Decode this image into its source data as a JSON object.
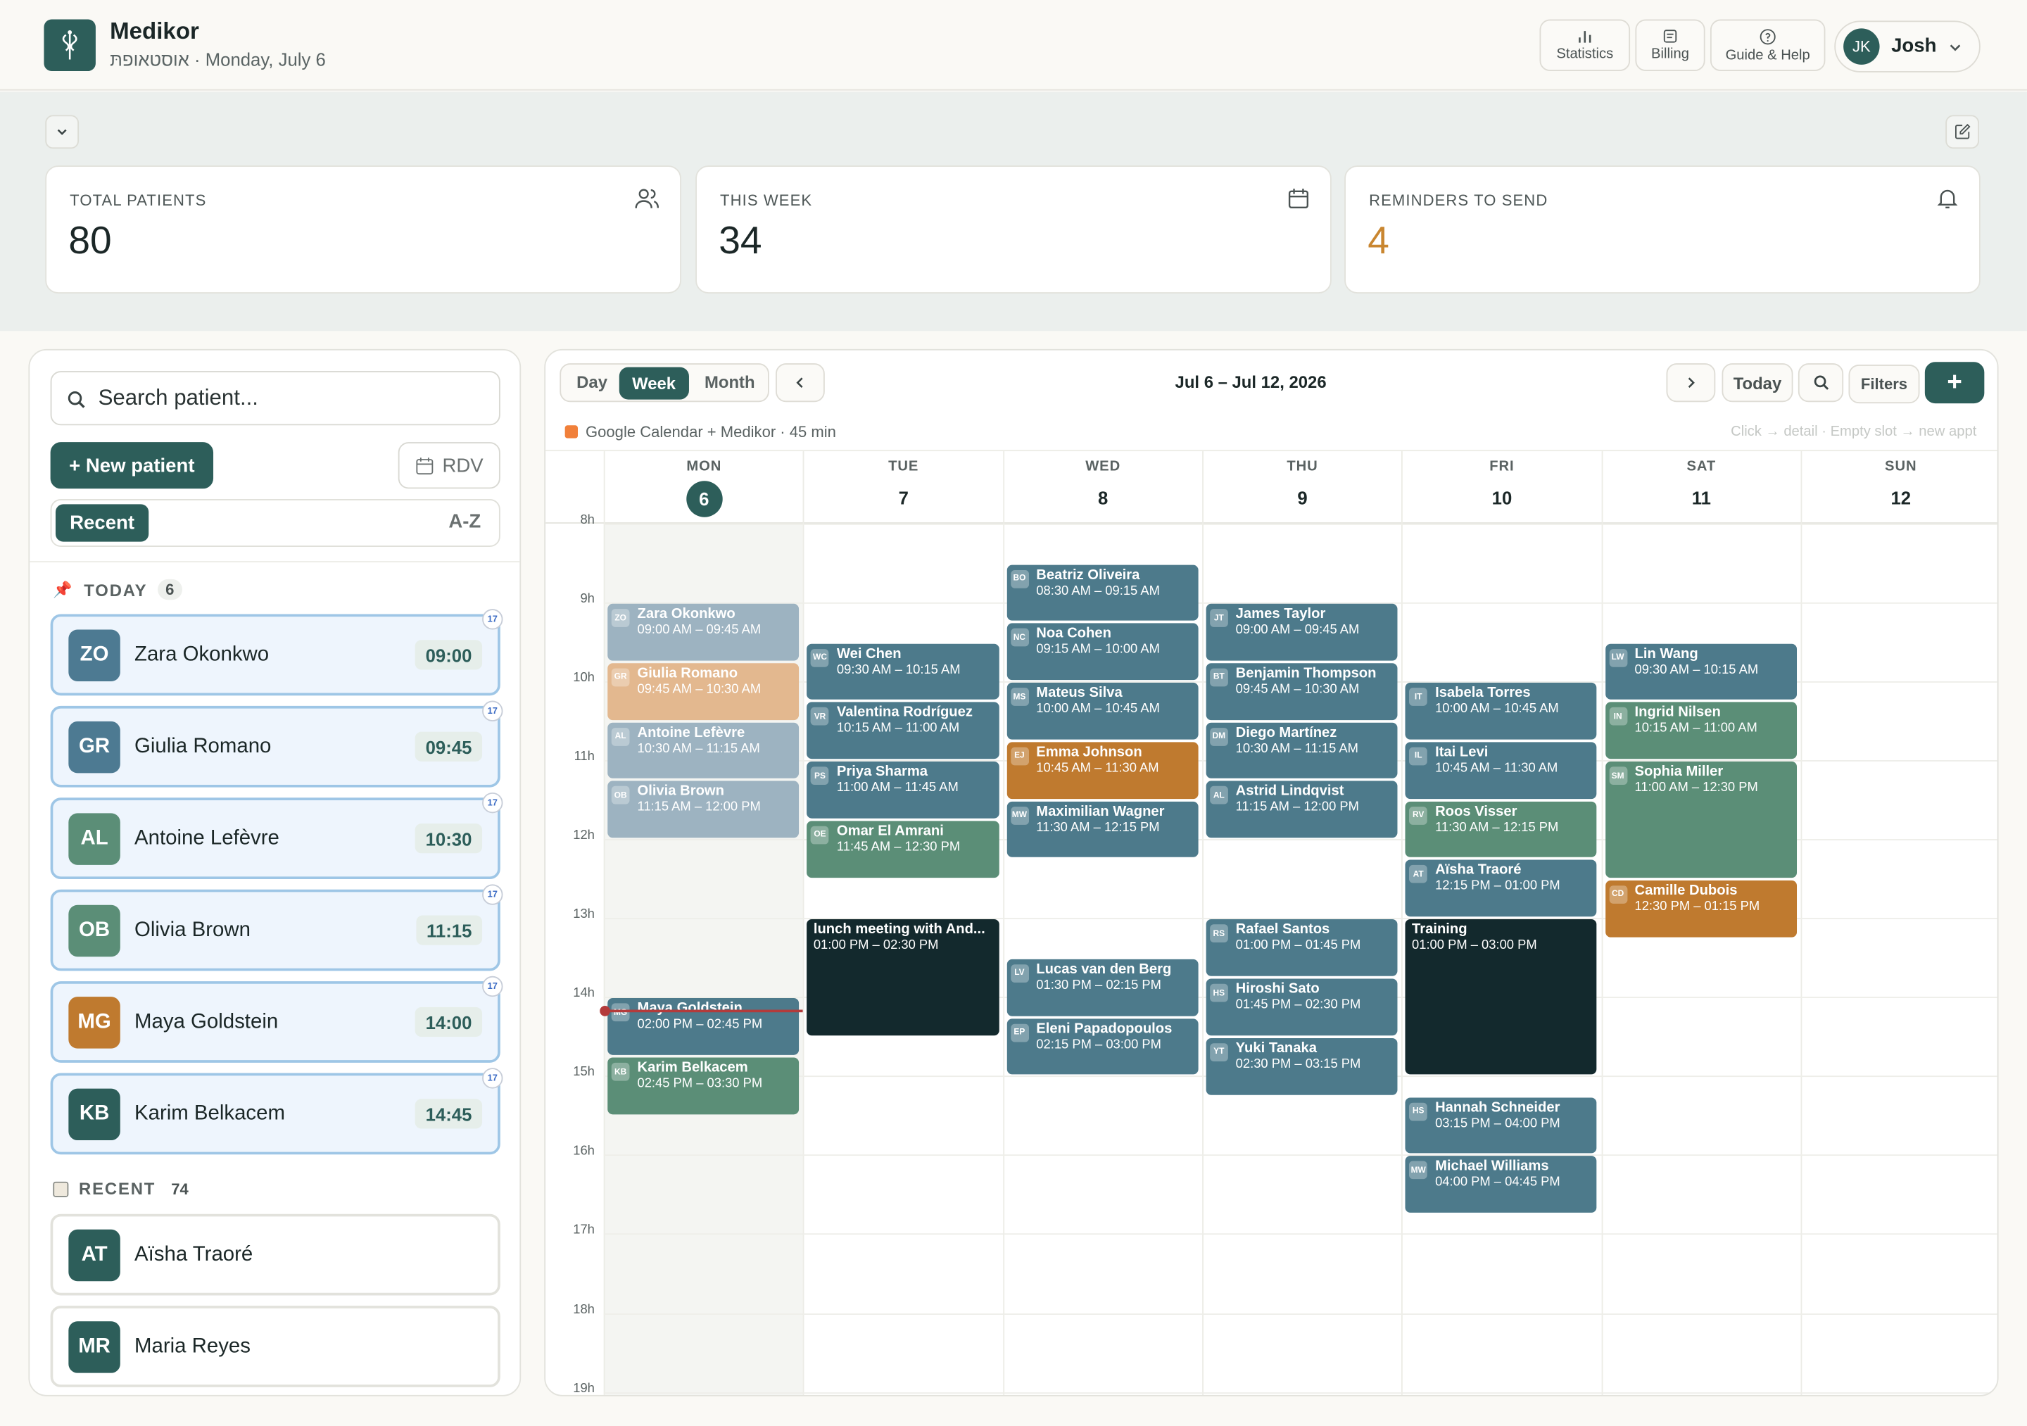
{
  "header": {
    "app_name": "Medikor",
    "subtitle": "אוסטאופתּ · Monday, July 6",
    "buttons": [
      {
        "label": "Statistics",
        "icon": "bar-chart-icon"
      },
      {
        "label": "Billing",
        "icon": "receipt-icon"
      },
      {
        "label": "Guide & Help",
        "icon": "help-circle-icon"
      }
    ],
    "user": {
      "initials": "JK",
      "name": "Josh"
    }
  },
  "stats": [
    {
      "label": "TOTAL PATIENTS",
      "value": "80",
      "icon": "users-icon"
    },
    {
      "label": "THIS WEEK",
      "value": "34",
      "icon": "calendar-icon"
    },
    {
      "label": "REMINDERS TO SEND",
      "value": "4",
      "icon": "bell-icon",
      "accent": "#c98630"
    }
  ],
  "sidebar": {
    "search_placeholder": "Search patient...",
    "new_patient": "+ New patient",
    "rdv": "RDV",
    "sort_recent": "Recent",
    "sort_az": "A-Z",
    "today_label": "TODAY",
    "today_count": "6",
    "today": [
      {
        "initials": "ZO",
        "name": "Zara Okonkwo",
        "time": "09:00",
        "color": "#4d7a92"
      },
      {
        "initials": "GR",
        "name": "Giulia Romano",
        "time": "09:45",
        "color": "#4d7a92"
      },
      {
        "initials": "AL",
        "name": "Antoine Lefèvre",
        "time": "10:30",
        "color": "#5b8e77"
      },
      {
        "initials": "OB",
        "name": "Olivia Brown",
        "time": "11:15",
        "color": "#5b8e77"
      },
      {
        "initials": "MG",
        "name": "Maya Goldstein",
        "time": "14:00",
        "color": "#bf7a2f"
      },
      {
        "initials": "KB",
        "name": "Karim Belkacem",
        "time": "14:45",
        "color": "#2d5e5a"
      }
    ],
    "recent_label": "RECENT",
    "recent_count": "74",
    "recent": [
      {
        "initials": "AT",
        "name": "Aïsha Traoré",
        "color": "#2d5e5a"
      },
      {
        "initials": "MR",
        "name": "Maria Reyes",
        "color": "#2d5e5a"
      }
    ]
  },
  "calendar": {
    "views": [
      "Day",
      "Week",
      "Month"
    ],
    "active_view": "Week",
    "range": "Jul 6 – Jul 12, 2026",
    "today_btn": "Today",
    "filters_btn": "Filters",
    "add_btn": "+",
    "source": "Google Calendar + Medikor · 45 min",
    "hint": "Click → detail · Empty slot → new appt",
    "days": [
      {
        "d": "MON",
        "n": "6",
        "today": true
      },
      {
        "d": "TUE",
        "n": "7"
      },
      {
        "d": "WED",
        "n": "8"
      },
      {
        "d": "THU",
        "n": "9"
      },
      {
        "d": "FRI",
        "n": "10"
      },
      {
        "d": "SAT",
        "n": "11"
      },
      {
        "d": "SUN",
        "n": "12"
      }
    ],
    "hours": [
      "8h",
      "9h",
      "10h",
      "11h",
      "12h",
      "13h",
      "14h",
      "15h",
      "16h",
      "17h",
      "18h",
      "19h"
    ],
    "events": [
      {
        "day": 0,
        "start": 9.0,
        "end": 9.75,
        "i": "ZO",
        "name": "Zara Okonkwo",
        "time": "09:00 AM – 09:45 AM",
        "color": "#9db3c1"
      },
      {
        "day": 0,
        "start": 9.75,
        "end": 10.5,
        "i": "GR",
        "name": "Giulia Romano",
        "time": "09:45 AM – 10:30 AM",
        "color": "#e3b88f"
      },
      {
        "day": 0,
        "start": 10.5,
        "end": 11.25,
        "i": "AL",
        "name": "Antoine Lefèvre",
        "time": "10:30 AM – 11:15 AM",
        "color": "#9db3c1"
      },
      {
        "day": 0,
        "start": 11.25,
        "end": 12.0,
        "i": "OB",
        "name": "Olivia Brown",
        "time": "11:15 AM – 12:00 PM",
        "color": "#9db3c1"
      },
      {
        "day": 0,
        "start": 14.0,
        "end": 14.75,
        "i": "MG",
        "name": "Maya Goldstein",
        "time": "02:00 PM – 02:45 PM",
        "color": "#4d7a8b"
      },
      {
        "day": 0,
        "start": 14.75,
        "end": 15.5,
        "i": "KB",
        "name": "Karim Belkacem",
        "time": "02:45 PM – 03:30 PM",
        "color": "#5b8e77"
      },
      {
        "day": 1,
        "start": 9.5,
        "end": 10.25,
        "i": "WC",
        "name": "Wei Chen",
        "time": "09:30 AM – 10:15 AM",
        "color": "#4d7a8b"
      },
      {
        "day": 1,
        "start": 10.25,
        "end": 11.0,
        "i": "VR",
        "name": "Valentina Rodríguez",
        "time": "10:15 AM – 11:00 AM",
        "color": "#4d7a8b"
      },
      {
        "day": 1,
        "start": 11.0,
        "end": 11.75,
        "i": "PS",
        "name": "Priya Sharma",
        "time": "11:00 AM – 11:45 AM",
        "color": "#4d7a8b"
      },
      {
        "day": 1,
        "start": 11.75,
        "end": 12.5,
        "i": "OE",
        "name": "Omar El Amrani",
        "time": "11:45 AM – 12:30 PM",
        "color": "#5b8e77"
      },
      {
        "day": 1,
        "start": 13.0,
        "end": 14.5,
        "i": "",
        "name": "lunch meeting with And...",
        "time": "01:00 PM – 02:30 PM",
        "color": "#13292d"
      },
      {
        "day": 2,
        "start": 8.5,
        "end": 9.25,
        "i": "BO",
        "name": "Beatriz Oliveira",
        "time": "08:30 AM – 09:15 AM",
        "color": "#4d7a8b"
      },
      {
        "day": 2,
        "start": 9.25,
        "end": 10.0,
        "i": "NC",
        "name": "Noa Cohen",
        "time": "09:15 AM – 10:00 AM",
        "color": "#4d7a8b"
      },
      {
        "day": 2,
        "start": 10.0,
        "end": 10.75,
        "i": "MS",
        "name": "Mateus Silva",
        "time": "10:00 AM – 10:45 AM",
        "color": "#4d7a8b"
      },
      {
        "day": 2,
        "start": 10.75,
        "end": 11.5,
        "i": "EJ",
        "name": "Emma Johnson",
        "time": "10:45 AM – 11:30 AM",
        "color": "#bf7a2f"
      },
      {
        "day": 2,
        "start": 11.5,
        "end": 12.25,
        "i": "MW",
        "name": "Maximilian Wagner",
        "time": "11:30 AM – 12:15 PM",
        "color": "#4d7a8b"
      },
      {
        "day": 2,
        "start": 13.5,
        "end": 14.25,
        "i": "LV",
        "name": "Lucas van den Berg",
        "time": "01:30 PM – 02:15 PM",
        "color": "#4d7a8b"
      },
      {
        "day": 2,
        "start": 14.25,
        "end": 15.0,
        "i": "EP",
        "name": "Eleni Papadopoulos",
        "time": "02:15 PM – 03:00 PM",
        "color": "#4d7a8b"
      },
      {
        "day": 3,
        "start": 9.0,
        "end": 9.75,
        "i": "JT",
        "name": "James Taylor",
        "time": "09:00 AM – 09:45 AM",
        "color": "#4d7a8b"
      },
      {
        "day": 3,
        "start": 9.75,
        "end": 10.5,
        "i": "BT",
        "name": "Benjamin Thompson",
        "time": "09:45 AM – 10:30 AM",
        "color": "#4d7a8b"
      },
      {
        "day": 3,
        "start": 10.5,
        "end": 11.25,
        "i": "DM",
        "name": "Diego Martínez",
        "time": "10:30 AM – 11:15 AM",
        "color": "#4d7a8b"
      },
      {
        "day": 3,
        "start": 11.25,
        "end": 12.0,
        "i": "AL",
        "name": "Astrid Lindqvist",
        "time": "11:15 AM – 12:00 PM",
        "color": "#4d7a8b"
      },
      {
        "day": 3,
        "start": 13.0,
        "end": 13.75,
        "i": "RS",
        "name": "Rafael Santos",
        "time": "01:00 PM – 01:45 PM",
        "color": "#4d7a8b"
      },
      {
        "day": 3,
        "start": 13.75,
        "end": 14.5,
        "i": "HS",
        "name": "Hiroshi Sato",
        "time": "01:45 PM – 02:30 PM",
        "color": "#4d7a8b"
      },
      {
        "day": 3,
        "start": 14.5,
        "end": 15.25,
        "i": "YT",
        "name": "Yuki Tanaka",
        "time": "02:30 PM – 03:15 PM",
        "color": "#4d7a8b"
      },
      {
        "day": 4,
        "start": 10.0,
        "end": 10.75,
        "i": "IT",
        "name": "Isabela Torres",
        "time": "10:00 AM – 10:45 AM",
        "color": "#4d7a8b"
      },
      {
        "day": 4,
        "start": 10.75,
        "end": 11.5,
        "i": "IL",
        "name": "Itai Levi",
        "time": "10:45 AM – 11:30 AM",
        "color": "#4d7a8b"
      },
      {
        "day": 4,
        "start": 11.5,
        "end": 12.25,
        "i": "RV",
        "name": "Roos Visser",
        "time": "11:30 AM – 12:15 PM",
        "color": "#5b8e77"
      },
      {
        "day": 4,
        "start": 12.25,
        "end": 13.0,
        "i": "AT",
        "name": "Aïsha Traoré",
        "time": "12:15 PM – 01:00 PM",
        "color": "#4d7a8b"
      },
      {
        "day": 4,
        "start": 13.0,
        "end": 15.0,
        "i": "",
        "name": "Training",
        "time": "01:00 PM – 03:00 PM",
        "color": "#13292d"
      },
      {
        "day": 4,
        "start": 15.25,
        "end": 16.0,
        "i": "HS",
        "name": "Hannah Schneider",
        "time": "03:15 PM – 04:00 PM",
        "color": "#4d7a8b"
      },
      {
        "day": 4,
        "start": 16.0,
        "end": 16.75,
        "i": "MW",
        "name": "Michael Williams",
        "time": "04:00 PM – 04:45 PM",
        "color": "#4d7a8b"
      },
      {
        "day": 5,
        "start": 9.5,
        "end": 10.25,
        "i": "LW",
        "name": "Lin Wang",
        "time": "09:30 AM – 10:15 AM",
        "color": "#4d7a8b"
      },
      {
        "day": 5,
        "start": 10.25,
        "end": 11.0,
        "i": "IN",
        "name": "Ingrid Nilsen",
        "time": "10:15 AM – 11:00 AM",
        "color": "#5b8e77"
      },
      {
        "day": 5,
        "start": 11.0,
        "end": 12.5,
        "i": "SM",
        "name": "Sophia Miller",
        "time": "11:00 AM – 12:30 PM",
        "color": "#5b8e77"
      },
      {
        "day": 5,
        "start": 12.5,
        "end": 13.25,
        "i": "CD",
        "name": "Camille Dubois",
        "time": "12:30 PM – 01:15 PM",
        "color": "#bf7a2f"
      }
    ]
  }
}
